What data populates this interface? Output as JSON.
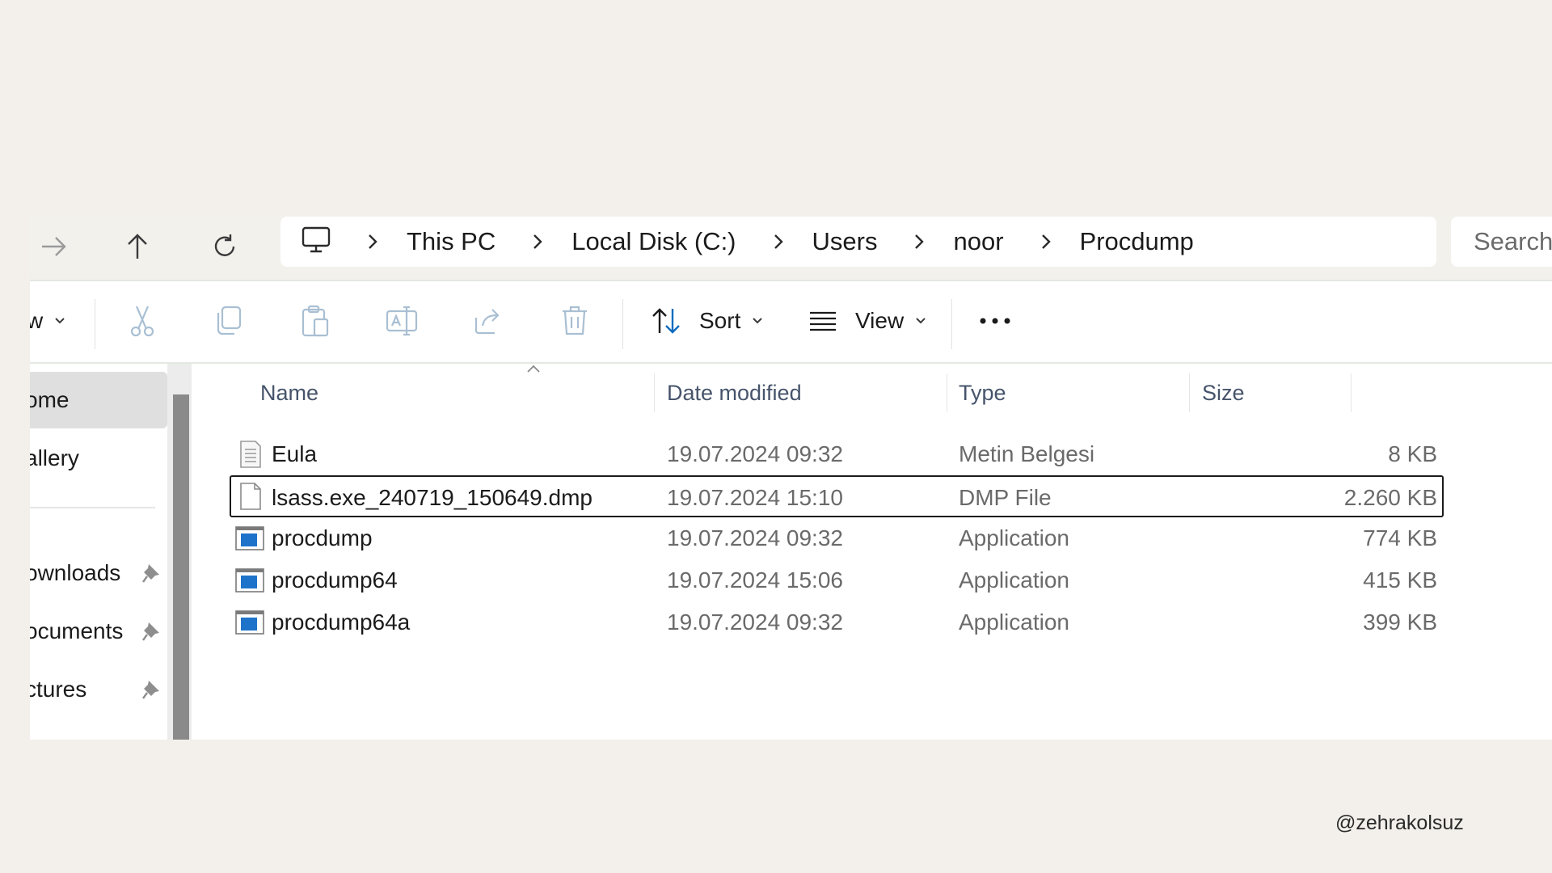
{
  "breadcrumb": {
    "items": [
      "This PC",
      "Local Disk (C:)",
      "Users",
      "noor",
      "Procdump"
    ]
  },
  "search": {
    "placeholder": "Search"
  },
  "toolbar": {
    "new_label_fragment": "w",
    "sort_label": "Sort",
    "view_label": "View"
  },
  "sidebar": {
    "items": [
      {
        "label": "ome",
        "pinned": false,
        "selected": true
      },
      {
        "label": "allery",
        "pinned": false,
        "selected": false
      },
      {
        "label": "ownloads",
        "pinned": true,
        "selected": false
      },
      {
        "label": "ocuments",
        "pinned": true,
        "selected": false
      },
      {
        "label": "ctures",
        "pinned": true,
        "selected": false
      }
    ]
  },
  "columns": {
    "name": "Name",
    "date": "Date modified",
    "type": "Type",
    "size": "Size"
  },
  "files": [
    {
      "name": "Eula",
      "date": "19.07.2024 09:32",
      "type": "Metin Belgesi",
      "size": "8 KB",
      "icon": "text-document-icon",
      "selected": false
    },
    {
      "name": "lsass.exe_240719_150649.dmp",
      "date": "19.07.2024 15:10",
      "type": "DMP File",
      "size": "2.260 KB",
      "icon": "blank-file-icon",
      "selected": true
    },
    {
      "name": "procdump",
      "date": "19.07.2024 09:32",
      "type": "Application",
      "size": "774 KB",
      "icon": "application-icon",
      "selected": false
    },
    {
      "name": "procdump64",
      "date": "19.07.2024 15:06",
      "type": "Application",
      "size": "415 KB",
      "icon": "application-icon",
      "selected": false
    },
    {
      "name": "procdump64a",
      "date": "19.07.2024 09:32",
      "type": "Application",
      "size": "399 KB",
      "icon": "application-icon",
      "selected": false
    }
  ],
  "credit": "@zehrakolsuz",
  "colors": {
    "accent": "#0f6cbd",
    "background": "#f3f0eb",
    "toolbar_icon_muted": "#a9bfd3"
  }
}
